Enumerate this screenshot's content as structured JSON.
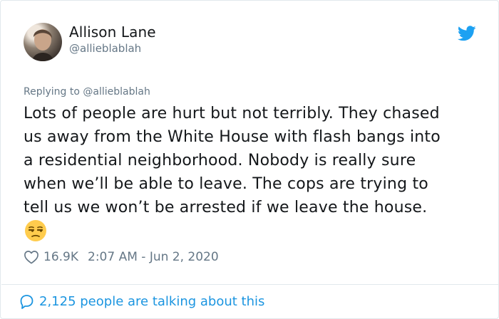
{
  "author": {
    "name": "Allison Lane",
    "handle": "@allieblablah"
  },
  "reply_context": "Replying to @allieblablah",
  "tweet": {
    "lines": [
      "Lots of people are hurt but not terribly. They chased",
      "us away from the White House with flash bangs into",
      "a residential neighborhood. Nobody is really sure",
      "when we’ll be able to leave. The cops are trying to",
      "tell us we won’t be arrested if we leave the house."
    ],
    "emoji": "unamused-face"
  },
  "meta": {
    "likes": "16.9K",
    "timestamp": "2:07 AM - Jun 2, 2020"
  },
  "footer": {
    "talking": "2,125 people are talking about this"
  },
  "colors": {
    "twitter_blue": "#1da1f2",
    "link_blue": "#1b95e0",
    "secondary_gray": "#657786",
    "text": "#14171a"
  },
  "icons": [
    "twitter-bird-icon",
    "heart-icon",
    "comment-icon",
    "unamused-face-emoji"
  ]
}
